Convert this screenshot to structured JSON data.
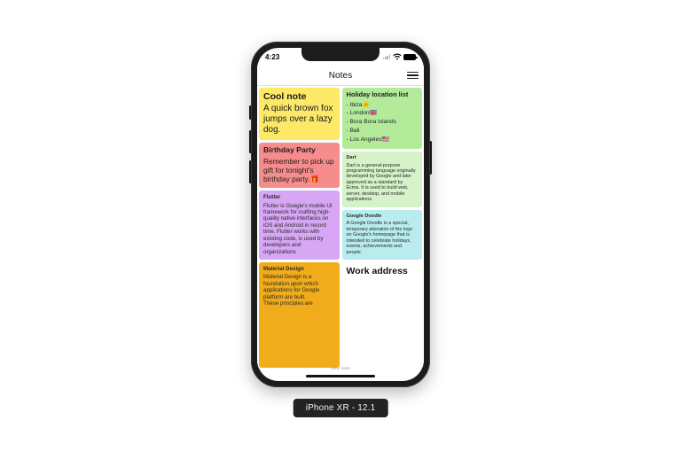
{
  "device": {
    "label": "iPhone XR - 12.1"
  },
  "status_bar": {
    "time": "4:23",
    "wifi_icon": "wifi-icon",
    "battery_icon": "battery-icon",
    "signal_icon": "signal-bars-icon"
  },
  "nav_bar": {
    "title": "Notes",
    "menu_icon": "hamburger-menu-icon"
  },
  "bottom": {
    "new_note_label": "New Note"
  },
  "colors": {
    "cool_note": "#fbe967",
    "birthday_party": "#f78c8c",
    "flutter": "#d7a6f5",
    "material_design": "#f0ac1b",
    "holiday_location": "#b4eb9a",
    "dart": "#d5f2c8",
    "google_doodle": "#b9ecee",
    "work_address": "#ffffff"
  },
  "notes": {
    "left_column": [
      {
        "id": "cool-note",
        "title": "Cool note",
        "body": "A quick brown fox jumps over a lazy dog.",
        "bg": "#fbe967",
        "text_color": "#1a1a1a",
        "size": "t-lg"
      },
      {
        "id": "birthday-party",
        "title": "Birthday Party",
        "body": "Remember to pick up gift for tonight's birthday party.🎁",
        "bg": "#f78c8c",
        "text_color": "#1f1f1f",
        "size": "t-md"
      },
      {
        "id": "flutter",
        "title": "Flutter",
        "body": "Flutter is Google's mobile UI framework for crafting high-quality native interfaces on iOS and Android in record time. Flutter works with existing code, is used by developers and organizations",
        "bg": "#d7a6f5",
        "text_color": "#2a2a2a",
        "size": "t-sm"
      },
      {
        "id": "material-design",
        "title": "Material Design",
        "body": "Material Design is a foundation upon which applications for Google platform are built.\nThese principles are",
        "bg": "#f0ac1b",
        "text_color": "#2a2a2a",
        "size": "t-sm"
      }
    ],
    "right_column": [
      {
        "id": "holiday-location-list",
        "title": "Holiday location list",
        "body": "- Ibiza🌞\n- London🇬🇧\n- Bora Bora Islands\n- Bali\n- Los Angeles🇺🇸",
        "bg": "#b4eb9a",
        "text_color": "#1f1f1f",
        "size": "t-list"
      },
      {
        "id": "dart",
        "title": "Dart",
        "body": "Dart is a general-purpose programming language originally developed by Google and later approved as a standard by Ecma. It is used to build web, server, desktop, and mobile applications.",
        "bg": "#d5f2c8",
        "text_color": "#2a2a2a",
        "size": "t-xs"
      },
      {
        "id": "google-doodle",
        "title": "Google Doodle",
        "body": "A Google Doodle is a special, temporary alteration of the logo on Google's homepage that is intended to celebrate holidays, events, achievements and people.",
        "bg": "#b9ecee",
        "text_color": "#2a2a2a",
        "size": "t-xs"
      },
      {
        "id": "work-address",
        "title": "Work address",
        "body": "",
        "bg": "#ffffff",
        "text_color": "#111111",
        "size": "t-lg"
      }
    ]
  }
}
